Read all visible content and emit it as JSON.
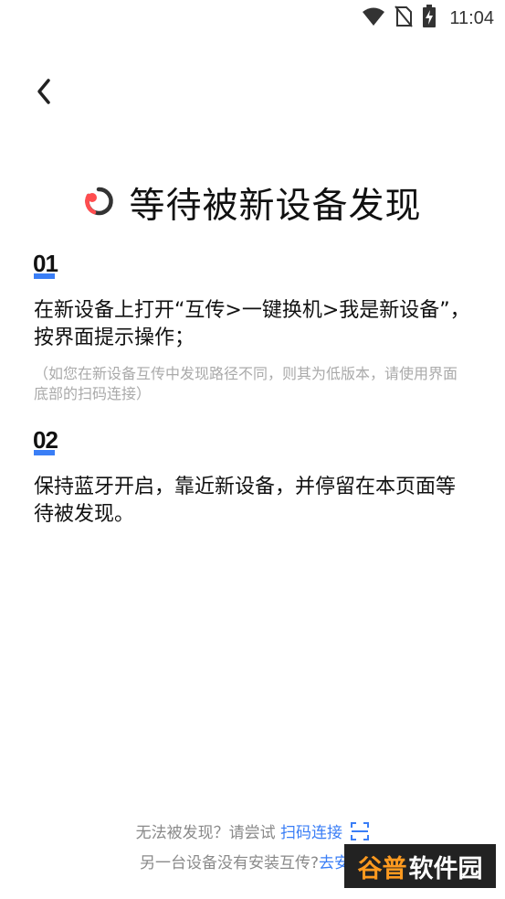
{
  "status_bar": {
    "time": "11:04",
    "icons": [
      "wifi-icon",
      "no-sim-icon",
      "battery-charging-icon"
    ]
  },
  "header": {
    "back_icon": "chevron-left-icon"
  },
  "title": {
    "logo_icon": "loop-logo-icon",
    "text": "等待被新设备发现",
    "logo_colors": {
      "primary": "#ff4d4f",
      "secondary": "#333333"
    }
  },
  "steps": [
    {
      "number": "01",
      "text": "在新设备上打开“互传>一键换机>我是新设备”，按界面提示操作；",
      "hint": "（如您在新设备互传中发现路径不同，则其为低版本，请使用界面底部的扫码连接）"
    },
    {
      "number": "02",
      "text": "保持蓝牙开启，靠近新设备，并停留在本页面等待被发现。"
    }
  ],
  "footer": {
    "line1_prefix": "无法被发现？请尝试 ",
    "line1_link": "扫码连接",
    "scan_icon": "scan-icon",
    "line2_prefix": "另一台设备没有安装互传?",
    "line2_link": "去安装"
  },
  "watermark": {
    "part1": "谷普",
    "part2": "软件园"
  },
  "colors": {
    "accent": "#3a7ef6",
    "hint": "#aaaaaa",
    "footer_text": "#8a8a8a"
  }
}
